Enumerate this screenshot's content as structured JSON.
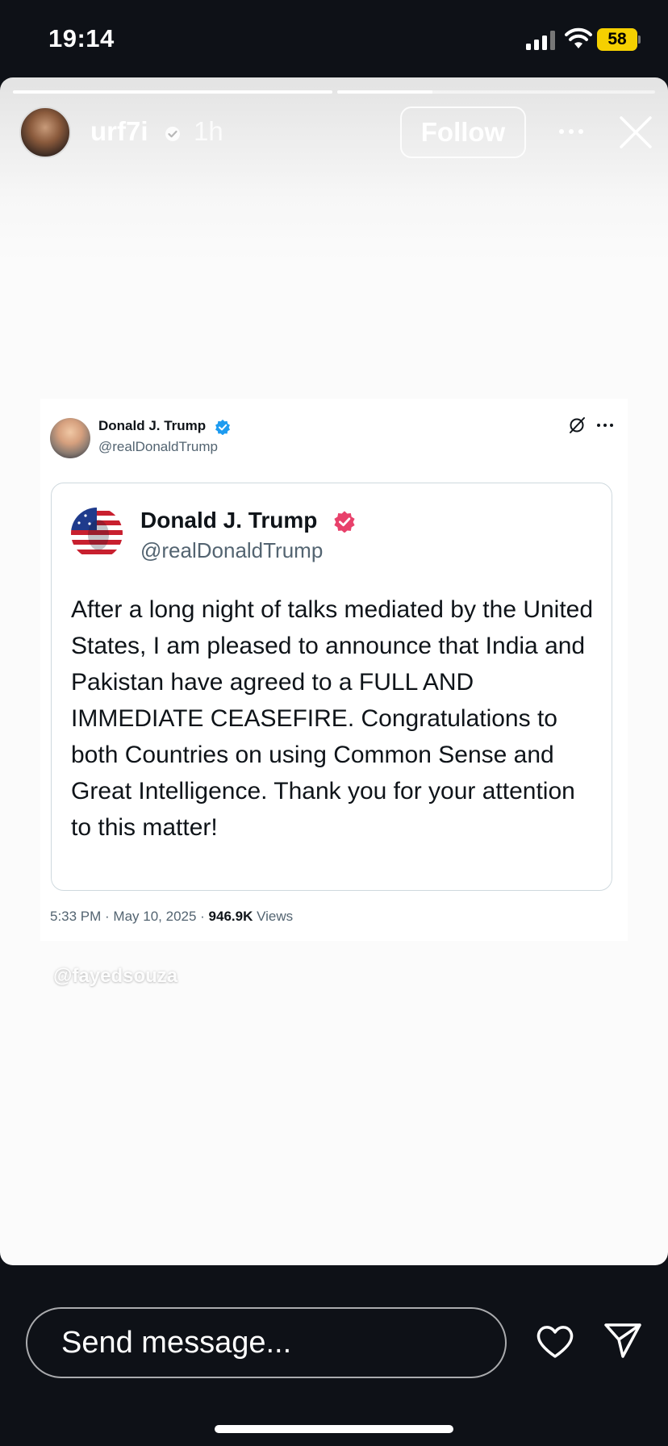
{
  "status_bar": {
    "time": "19:14",
    "battery": "58",
    "battery_color": "#f5d000"
  },
  "story": {
    "progress": [
      1.0,
      0.3
    ],
    "username": "urf7i",
    "time_ago": "1h",
    "follow_label": "Follow",
    "more_icon": "ellipsis-icon",
    "close_icon": "close-icon"
  },
  "tweet": {
    "name": "Donald J. Trump",
    "handle": "@realDonaldTrump",
    "verified_color": "#1d9bf0",
    "quoted": {
      "name": "Donald J. Trump",
      "handle": "@realDonaldTrump",
      "verified_color": "#e8416b",
      "text": "After a long night of talks mediated by the United States, I am pleased to announce that India and Pakistan have agreed to a FULL AND IMMEDIATE CEASEFIRE. Congratulations to both Countries on using Common Sense and Great Intelligence. Thank you for your attention to this matter!"
    },
    "timestamp": "5:33 PM · May 10, 2025 · ",
    "views_count": "946.9K",
    "views_label": " Views"
  },
  "watermark": "@fayedsouza",
  "footer": {
    "message_placeholder": "Send message...",
    "heart_icon": "heart-icon",
    "send_icon": "send-icon"
  }
}
